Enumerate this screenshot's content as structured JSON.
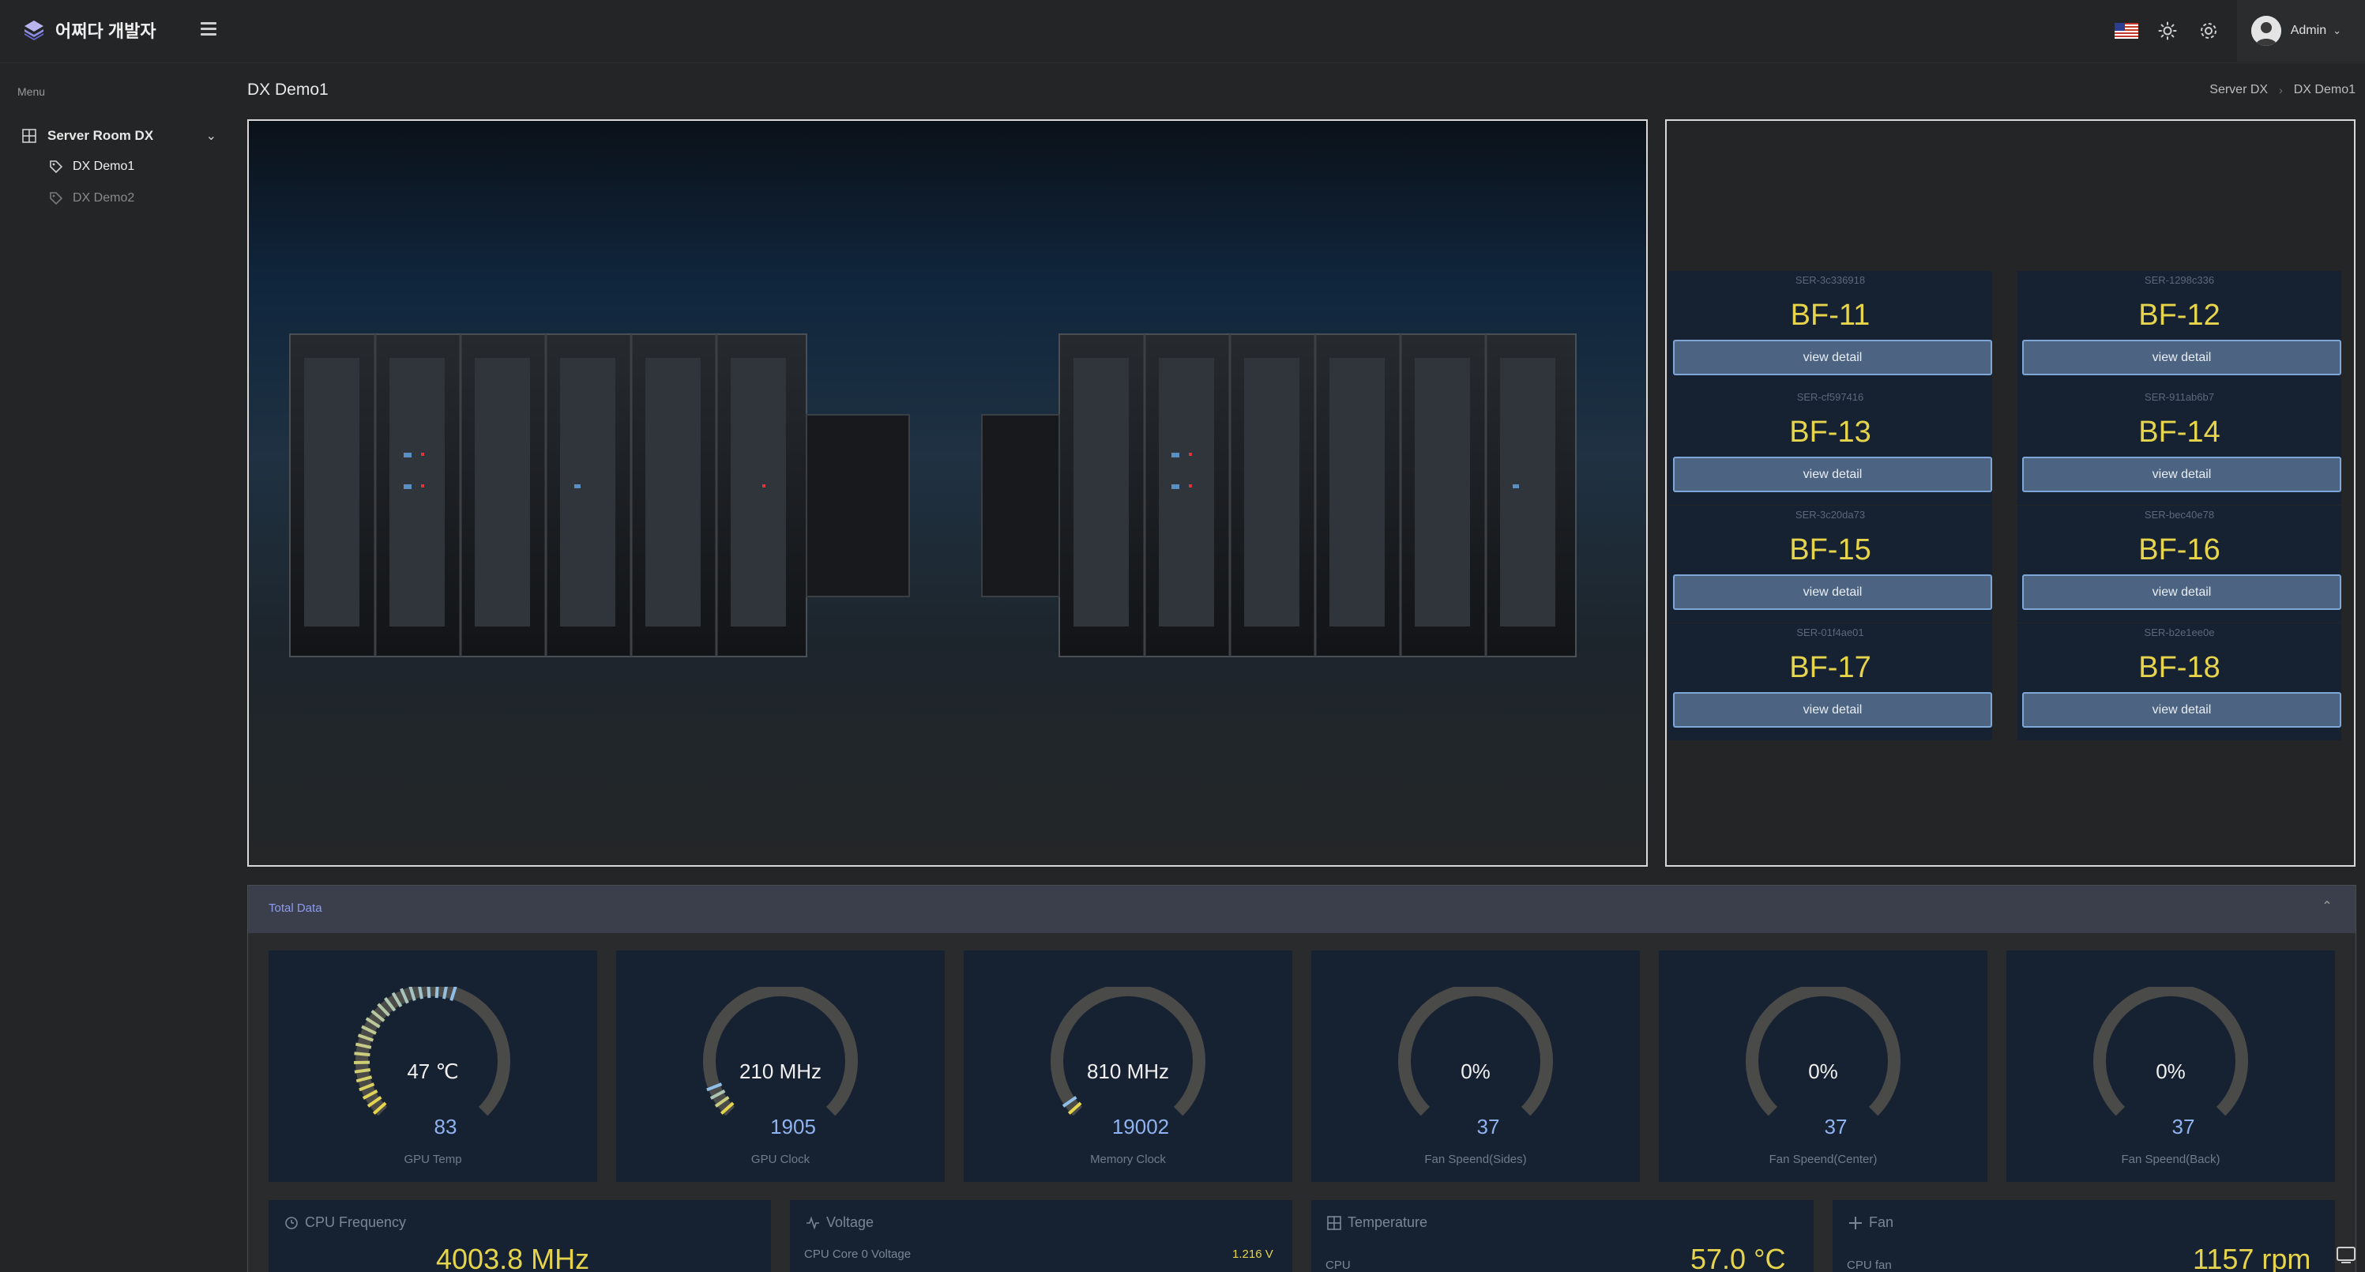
{
  "app": {
    "brand": "어쩌다 개발자",
    "admin_name": "Admin"
  },
  "header_icons": [
    "us-flag-icon",
    "sun-icon",
    "gear-icon"
  ],
  "sidebar": {
    "menu_title": "Menu",
    "group_label": "Server Room DX",
    "items": [
      {
        "label": "DX Demo1",
        "active": true
      },
      {
        "label": "DX Demo2",
        "active": false
      }
    ]
  },
  "page": {
    "title": "DX Demo1",
    "breadcrumb": [
      "Server DX",
      "DX Demo1"
    ]
  },
  "servers": [
    {
      "serial": "SER-3c336918",
      "name": "BF-11",
      "button": "view detail"
    },
    {
      "serial": "SER-1298c336",
      "name": "BF-12",
      "button": "view detail"
    },
    {
      "serial": "SER-cf597416",
      "name": "BF-13",
      "button": "view detail"
    },
    {
      "serial": "SER-911ab6b7",
      "name": "BF-14",
      "button": "view detail"
    },
    {
      "serial": "SER-3c20da73",
      "name": "BF-15",
      "button": "view detail"
    },
    {
      "serial": "SER-bec40e78",
      "name": "BF-16",
      "button": "view detail"
    },
    {
      "serial": "SER-01f4ae01",
      "name": "BF-17",
      "button": "view detail"
    },
    {
      "serial": "SER-b2e1ee0e",
      "name": "BF-18",
      "button": "view detail"
    }
  ],
  "total_data": {
    "title": "Total Data",
    "gauges": [
      {
        "value": "47 ℃",
        "max": "83",
        "label": "GPU Temp",
        "fill": 0.57
      },
      {
        "value": "210 MHz",
        "max": "1905",
        "label": "GPU Clock",
        "fill": 0.11
      },
      {
        "value": "810 MHz",
        "max": "19002",
        "label": "Memory Clock",
        "fill": 0.04
      },
      {
        "value": "0%",
        "max": "37",
        "label": "Fan Speend(Sides)",
        "fill": 0
      },
      {
        "value": "0%",
        "max": "37",
        "label": "Fan Speend(Center)",
        "fill": 0
      },
      {
        "value": "0%",
        "max": "37",
        "label": "Fan Speend(Back)",
        "fill": 0
      }
    ],
    "stats": {
      "cpu_frequency": {
        "title": "CPU Frequency",
        "value": "4003.8 MHz"
      },
      "voltage": {
        "title": "Voltage",
        "row_label": "CPU Core 0 Voltage",
        "row_value": "1.216 V"
      },
      "temperature": {
        "title": "Temperature",
        "row_label": "CPU",
        "value": "57.0 °C"
      },
      "fan": {
        "title": "Fan",
        "row_label": "CPU fan",
        "value": "1157 rpm"
      }
    }
  },
  "colors": {
    "accent_yellow": "#e6d44c",
    "gauge_blue": "#8fb3f0",
    "button_blue": "#4c6382",
    "card_bg": "#162131",
    "page_bg": "#242526"
  }
}
